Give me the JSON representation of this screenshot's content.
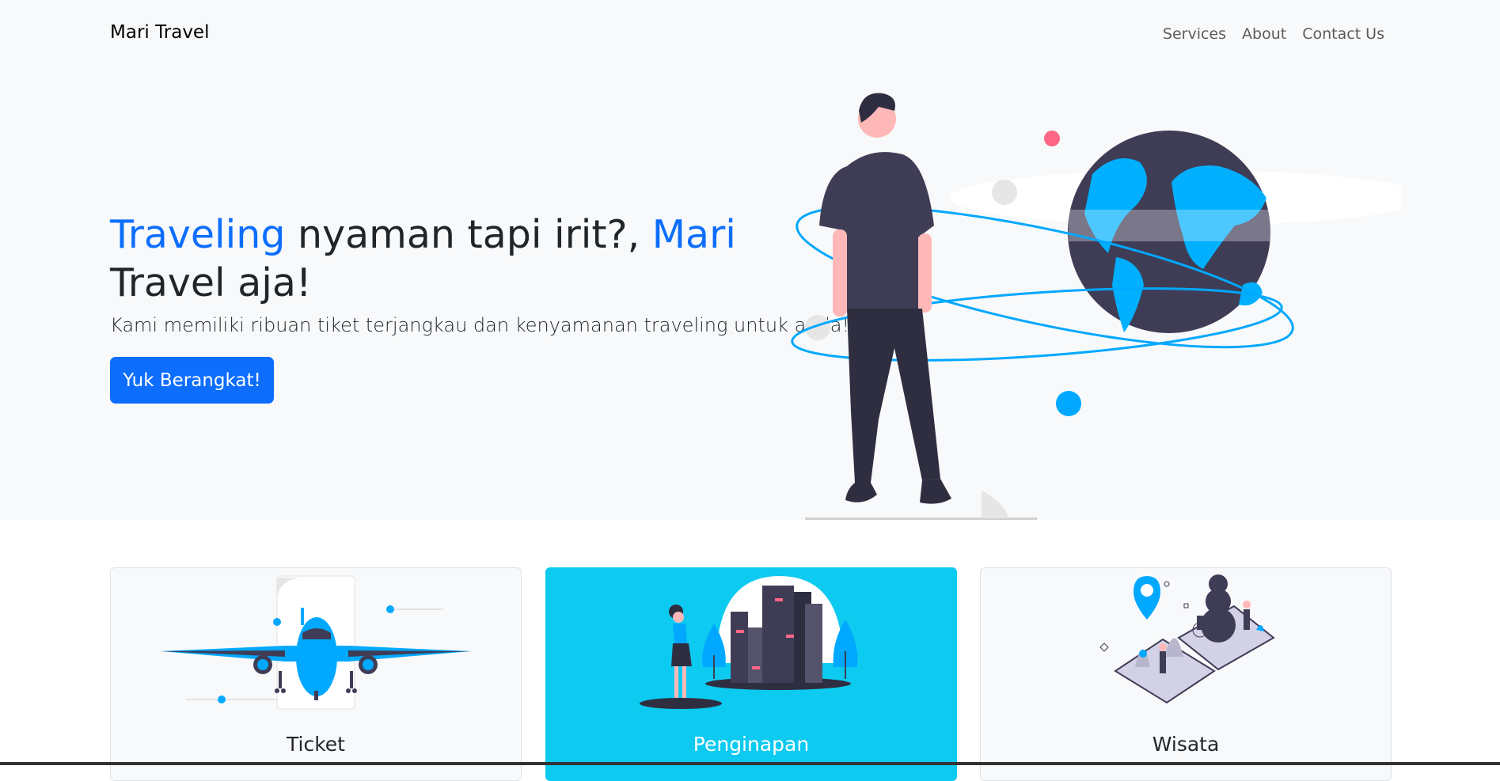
{
  "navbar": {
    "brand": "Mari Travel",
    "links": [
      "Services",
      "About",
      "Contact Us"
    ]
  },
  "hero": {
    "headline_part1": "Traveling",
    "headline_part2": " nyaman tapi irit?, ",
    "headline_part3": "Mari",
    "headline_part4": "Travel aja!",
    "lead": "Kami memiliki ribuan tiket terjangkau dan kenyamanan traveling untuk anda!",
    "cta_label": "Yuk Berangkat!"
  },
  "cards": [
    {
      "title": "Ticket"
    },
    {
      "title": "Penginapan"
    },
    {
      "title": "Wisata"
    }
  ],
  "colors": {
    "accent": "#0d6efd",
    "cyan": "#0dcaf0",
    "illustration_blue": "#00b0ff",
    "dark": "#3f3d56"
  }
}
